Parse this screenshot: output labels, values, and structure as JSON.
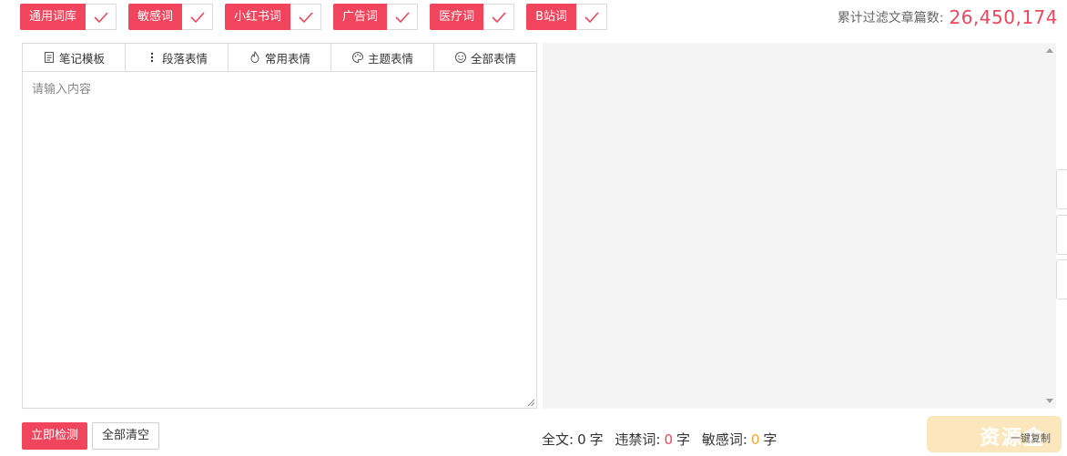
{
  "filters": [
    {
      "label": "通用词库",
      "checked": true
    },
    {
      "label": "敏感词",
      "checked": true
    },
    {
      "label": "小红书词",
      "checked": true
    },
    {
      "label": "广告词",
      "checked": true
    },
    {
      "label": "医疗词",
      "checked": true
    },
    {
      "label": "B站词",
      "checked": true
    }
  ],
  "total": {
    "label": "累计过滤文章篇数:",
    "value": "26,450,174"
  },
  "toolbar": [
    {
      "label": "笔记模板",
      "icon": "note-template-icon"
    },
    {
      "label": "段落表情",
      "icon": "vertical-dots-icon"
    },
    {
      "label": "常用表情",
      "icon": "fire-icon"
    },
    {
      "label": "主题表情",
      "icon": "palette-icon"
    },
    {
      "label": "全部表情",
      "icon": "smiley-icon"
    }
  ],
  "editor": {
    "placeholder": "请输入内容",
    "value": ""
  },
  "buttons": {
    "check": "立即检测",
    "clear": "全部清空"
  },
  "stats": {
    "full_label": "全文:",
    "full_value": "0",
    "unit": "字",
    "banned_label": "违禁词:",
    "banned_value": "0",
    "sensitive_label": "敏感词:",
    "sensitive_value": "0"
  },
  "colors": {
    "accent": "#f0455c",
    "sensitive": "#f5a623"
  },
  "watermark": {
    "text": "资源盒",
    "overlap_text": "一键复制"
  }
}
